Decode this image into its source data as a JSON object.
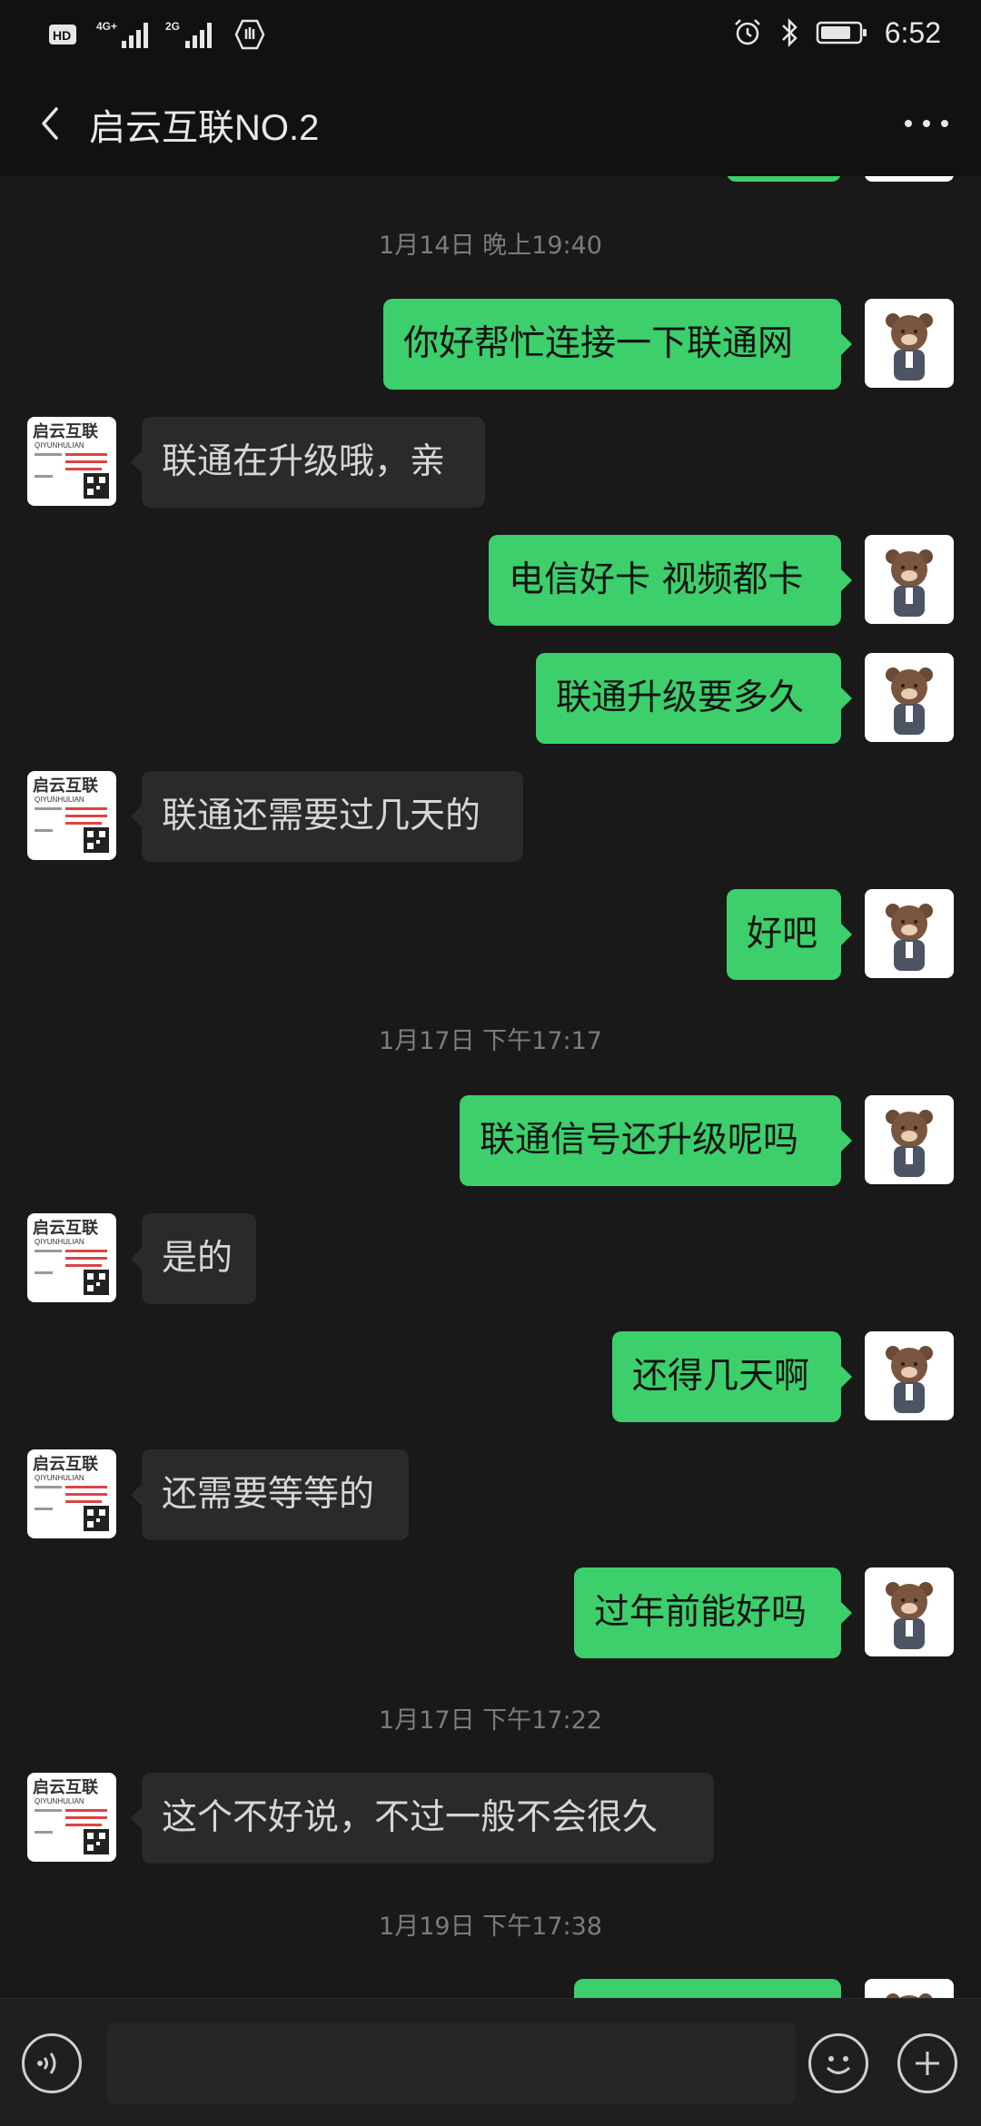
{
  "status_bar": {
    "indicators": [
      "HD",
      "4G+",
      "2G"
    ],
    "time": "6:52"
  },
  "header": {
    "title": "启云互联NO.2"
  },
  "messages": [
    {
      "type": "time",
      "text": "1月14日 晚上19:40"
    },
    {
      "type": "out",
      "text": "你好帮忙连接一下联通网"
    },
    {
      "type": "in",
      "text": "联通在升级哦，亲"
    },
    {
      "type": "out",
      "text": "电信好卡 视频都卡"
    },
    {
      "type": "out",
      "text": "联通升级要多久"
    },
    {
      "type": "in",
      "text": "联通还需要过几天的"
    },
    {
      "type": "out",
      "text": "好吧"
    },
    {
      "type": "time",
      "text": "1月17日 下午17:17"
    },
    {
      "type": "out",
      "text": "联通信号还升级呢吗"
    },
    {
      "type": "in",
      "text": "是的"
    },
    {
      "type": "out",
      "text": "还得几天啊"
    },
    {
      "type": "in",
      "text": "还需要等等的"
    },
    {
      "type": "out",
      "text": "过年前能好吗"
    },
    {
      "type": "time",
      "text": "1月17日 下午17:22"
    },
    {
      "type": "in",
      "text": "这个不好说，不过一般不会很久"
    },
    {
      "type": "time",
      "text": "1月19日 下午17:38"
    }
  ],
  "contact_avatar_logo": {
    "brand": "启云互联",
    "sub": "QIYUNHULIAN"
  },
  "colors": {
    "outgoing_bubble": "#3ccf6b",
    "incoming_bubble": "#2a2a2a",
    "background": "#191919"
  },
  "icons": [
    "back-arrow-icon",
    "more-dots-icon",
    "voice-icon",
    "emoji-icon",
    "plus-icon",
    "alarm-icon",
    "bluetooth-icon",
    "battery-icon"
  ]
}
